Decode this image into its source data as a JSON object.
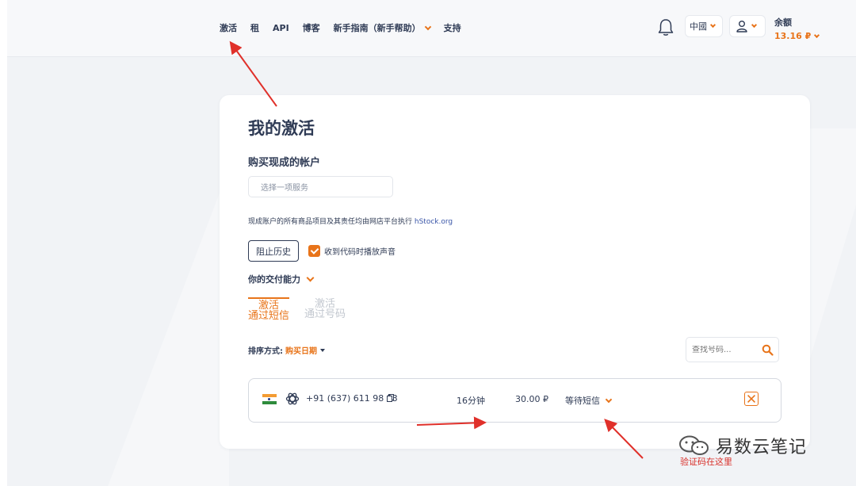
{
  "header": {
    "nav": [
      {
        "label": "激活"
      },
      {
        "label": "租"
      },
      {
        "label": "API"
      },
      {
        "label": "博客"
      },
      {
        "label": "新手指南（新手帮助）"
      },
      {
        "label": "支持"
      }
    ],
    "language": "中國",
    "balance_label": "余额",
    "balance_amount": "13.16 ₽"
  },
  "main": {
    "title": "我的激活",
    "subtitle": "购买现成的帐户",
    "service_placeholder": "选择一项服务",
    "notice_text": "现成账户的所有商品项目及其责任均由网店平台执行 ",
    "notice_link": "hStock.org",
    "history_button": "阻止历史",
    "sound_label": "收到代码时播放声音",
    "delivery_label": "你的交付能力",
    "tabs": [
      {
        "line1": "激活",
        "line2": "通过短信",
        "active": true
      },
      {
        "line1": "激活",
        "line2": "通过号码",
        "active": false
      }
    ],
    "sort_label": "排序方式:",
    "sort_value": "购买日期",
    "search_placeholder": "查找号码...",
    "activation": {
      "country_flag": "india-flag",
      "service_icon": "openai-icon",
      "phone": "+91 (637) 611 98 93",
      "time_left": "16分钟",
      "price": "30.00 ₽",
      "status": "等待短信"
    }
  },
  "annotation": {
    "text": "验证码在这里",
    "watermark": "易数云笔记"
  },
  "colors": {
    "accent": "#e8741a",
    "text": "#2f3b55",
    "annotation": "#d9302a"
  }
}
